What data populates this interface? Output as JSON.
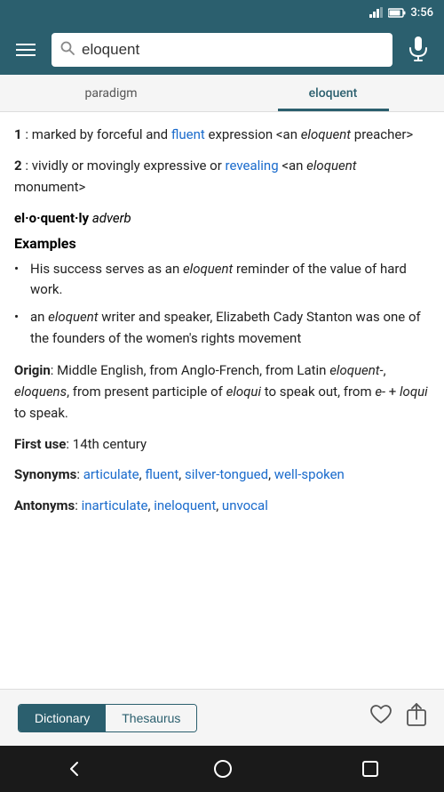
{
  "statusBar": {
    "time": "3:56"
  },
  "header": {
    "searchValue": "eloquent",
    "searchPlaceholder": "Search",
    "hamburgerLabel": "Menu"
  },
  "tabs": [
    {
      "id": "paradigm",
      "label": "paradigm",
      "active": false
    },
    {
      "id": "eloquent",
      "label": "eloquent",
      "active": true
    }
  ],
  "content": {
    "definition1": {
      "number": "1",
      "text1": " : marked by forceful and ",
      "link1": "fluent",
      "text2": " expression <an ",
      "italic1": "eloquent",
      "text3": " preacher>"
    },
    "definition2": {
      "number": "2",
      "text1": " : vividly or movingly expressive or ",
      "link1": "revealing",
      "text2": " <an ",
      "italic1": "eloquent",
      "text3": " monument>"
    },
    "adverb": {
      "word": "el·o·quent·ly",
      "partOfSpeech": "adverb"
    },
    "examples": {
      "title": "Examples",
      "bullets": [
        "His success serves as an eloquent reminder of the value of hard work.",
        "an eloquent writer and speaker, Elizabeth Cady Stanton was one of the founders of the women's rights movement"
      ]
    },
    "origin": {
      "label": "Origin",
      "text": ": Middle English, from Anglo-French, from Latin eloquent-, eloquens, from present participle of eloqui to speak out, from e- + loqui to speak."
    },
    "firstUse": {
      "label": "First use",
      "text": ": 14th century"
    },
    "synonyms": {
      "label": "Synonyms",
      "links": [
        "articulate",
        "fluent",
        "silver-tongued",
        "well-spoken"
      ]
    },
    "antonyms": {
      "label": "Antonyms",
      "links": [
        "inarticulate",
        "ineloquent",
        "unvocal"
      ]
    }
  },
  "bottomBar": {
    "dictionaryLabel": "Dictionary",
    "thesaurusLabel": "Thesaurus",
    "activeTab": "dictionary"
  },
  "navBar": {
    "backLabel": "Back",
    "homeLabel": "Home",
    "squareLabel": "Recent"
  }
}
